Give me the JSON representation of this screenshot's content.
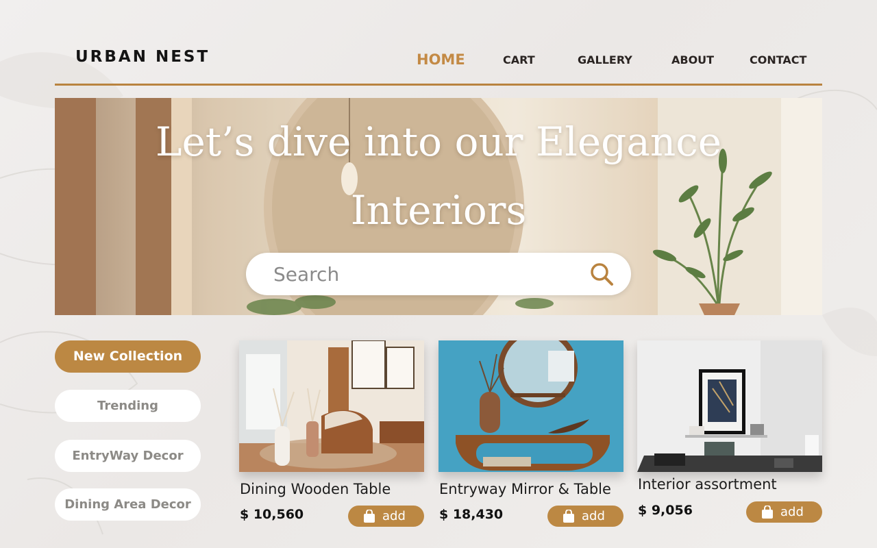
{
  "brand": "URBAN NEST",
  "nav": [
    {
      "label": "HOME",
      "active": true
    },
    {
      "label": "CART",
      "active": false
    },
    {
      "label": "GALLERY",
      "active": false
    },
    {
      "label": "ABOUT",
      "active": false
    },
    {
      "label": "CONTACT",
      "active": false
    }
  ],
  "hero": {
    "title_line1": "Let’s dive into our Elegance",
    "title_line2": "Interiors",
    "search_placeholder": "Search"
  },
  "categories": [
    {
      "label": "New Collection",
      "active": true
    },
    {
      "label": "Trending",
      "active": false
    },
    {
      "label": "EntryWay Decor",
      "active": false
    },
    {
      "label": "Dining Area Decor",
      "active": false
    }
  ],
  "products": [
    {
      "title": "Dining Wooden Table",
      "price": "$ 10,560",
      "add_label": "add"
    },
    {
      "title": "Entryway Mirror & Table",
      "price": "$ 18,430",
      "add_label": "add"
    },
    {
      "title": "Interior assortment",
      "price": "$ 9,056",
      "add_label": "add"
    }
  ],
  "colors": {
    "accent": "#bc8843",
    "nav_active": "#c38a45",
    "pill_inactive_text": "#8c8a86"
  },
  "icons": {
    "search": "search-icon",
    "cart_add": "shopping-bag-icon"
  }
}
